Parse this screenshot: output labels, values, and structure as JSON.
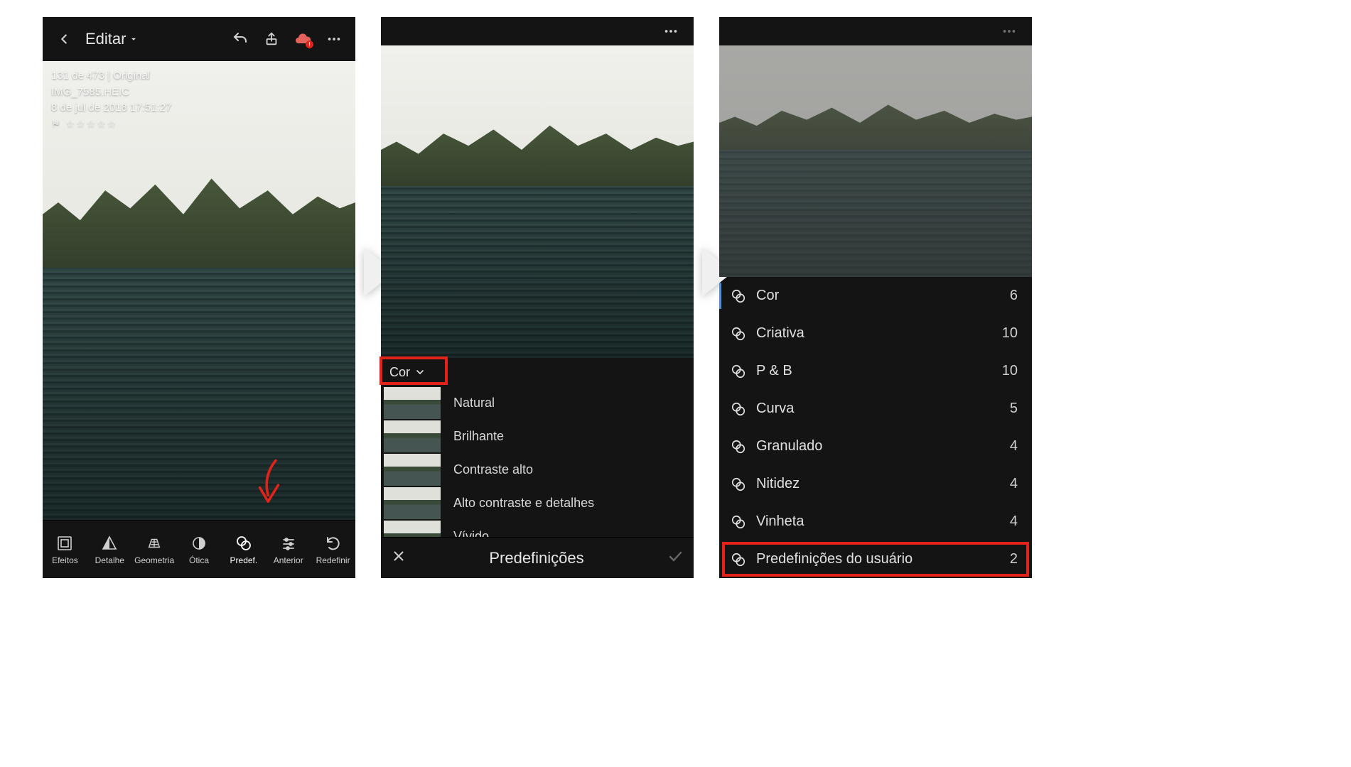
{
  "screen1": {
    "edit_label": "Editar",
    "info": {
      "position_line": "131 de 473 | Original",
      "filename": "IMG_7585.HEIC",
      "datetime": "8 de jul de 2018 17:51:27"
    },
    "toolbar": [
      {
        "icon": "effects-icon",
        "label": "Efeitos"
      },
      {
        "icon": "detail-icon",
        "label": "Detalhe"
      },
      {
        "icon": "geometry-icon",
        "label": "Geometria"
      },
      {
        "icon": "optics-icon",
        "label": "Ótica"
      },
      {
        "icon": "presets-icon",
        "label": "Predef."
      },
      {
        "icon": "previous-icon",
        "label": "Anterior"
      },
      {
        "icon": "reset-icon",
        "label": "Redefinir"
      }
    ]
  },
  "screen2": {
    "category_label": "Cor",
    "presets": [
      "Natural",
      "Brilhante",
      "Contraste alto",
      "Alto contraste e detalhes",
      "Vívido"
    ],
    "panel_title": "Predefinições"
  },
  "screen3": {
    "categories": [
      {
        "label": "Cor",
        "count": 6,
        "selected": true
      },
      {
        "label": "Criativa",
        "count": 10,
        "selected": false
      },
      {
        "label": "P & B",
        "count": 10,
        "selected": false
      },
      {
        "label": "Curva",
        "count": 5,
        "selected": false
      },
      {
        "label": "Granulado",
        "count": 4,
        "selected": false
      },
      {
        "label": "Nitidez",
        "count": 4,
        "selected": false
      },
      {
        "label": "Vinheta",
        "count": 4,
        "selected": false
      },
      {
        "label": "Predefinições do usuário",
        "count": 2,
        "selected": false
      }
    ]
  }
}
